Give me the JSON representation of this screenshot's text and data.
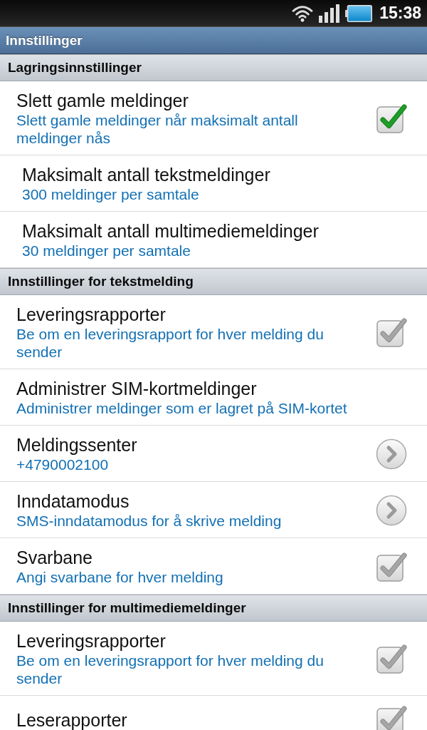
{
  "status_bar": {
    "time": "15:38"
  },
  "title_bar": {
    "title": "Innstillinger"
  },
  "sections": [
    {
      "header": "Lagringsinnstillinger",
      "items": [
        {
          "kind": "checkbox",
          "title": "Slett gamle meldinger",
          "summary": "Slett gamle meldinger når maksimalt antall meldinger nås",
          "checked": true
        },
        {
          "kind": "limit",
          "title": "Maksimalt antall tekstmeldinger",
          "summary": "300 meldinger per samtale"
        },
        {
          "kind": "limit",
          "title": "Maksimalt antall multimediemeldinger",
          "summary": "30 meldinger per samtale"
        }
      ]
    },
    {
      "header": "Innstillinger for tekstmelding",
      "items": [
        {
          "kind": "checkbox",
          "title": "Leveringsrapporter",
          "summary": "Be om en leveringsrapport for hver melding du sender",
          "checked": false
        },
        {
          "kind": "plain",
          "title": "Administrer SIM-kortmeldinger",
          "summary": "Administrer meldinger som er lagret på SIM-kortet"
        },
        {
          "kind": "arrow",
          "title": "Meldingssenter",
          "summary": "+4790002100"
        },
        {
          "kind": "arrow",
          "title": "Inndatamodus",
          "summary": "SMS-inndatamodus for å skrive melding"
        },
        {
          "kind": "checkbox",
          "title": "Svarbane",
          "summary": "Angi svarbane for hver melding",
          "checked": false
        }
      ]
    },
    {
      "header": "Innstillinger for multimediemeldinger",
      "items": [
        {
          "kind": "checkbox",
          "title": "Leveringsrapporter",
          "summary": "Be om en leveringsrapport for hver melding du sender",
          "checked": false
        },
        {
          "kind": "checkbox",
          "title": "Leserapporter",
          "checked": false
        }
      ]
    }
  ]
}
